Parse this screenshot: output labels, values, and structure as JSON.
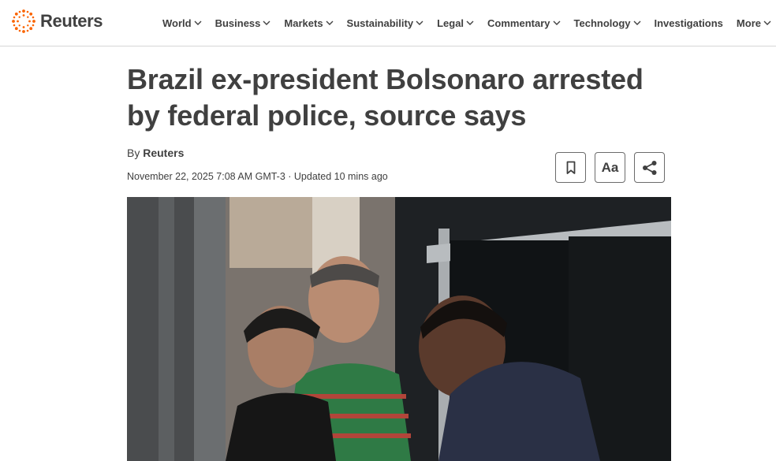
{
  "site": {
    "brand": "Reuters",
    "accent": "#fa6400"
  },
  "nav": {
    "items": [
      {
        "label": "World",
        "dropdown": true
      },
      {
        "label": "Business",
        "dropdown": true
      },
      {
        "label": "Markets",
        "dropdown": true
      },
      {
        "label": "Sustainability",
        "dropdown": true
      },
      {
        "label": "Legal",
        "dropdown": true
      },
      {
        "label": "Commentary",
        "dropdown": true
      },
      {
        "label": "Technology",
        "dropdown": true
      },
      {
        "label": "Investigations",
        "dropdown": false
      },
      {
        "label": "More",
        "dropdown": true
      }
    ]
  },
  "article": {
    "headline": "Brazil ex-president Bolsonaro arrested by federal police, source says",
    "byline_prefix": "By",
    "author": "Reuters",
    "dateline": "November 22, 2025 7:08 AM GMT-3 · Updated 10 mins ago"
  },
  "tools": {
    "bookmark_icon": "bookmark-icon",
    "text_size_label": "Aa",
    "share_icon": "share-icon"
  },
  "colors": {
    "text": "#404040",
    "divider": "#d6d6d6",
    "button_border": "#6b6b6b"
  }
}
